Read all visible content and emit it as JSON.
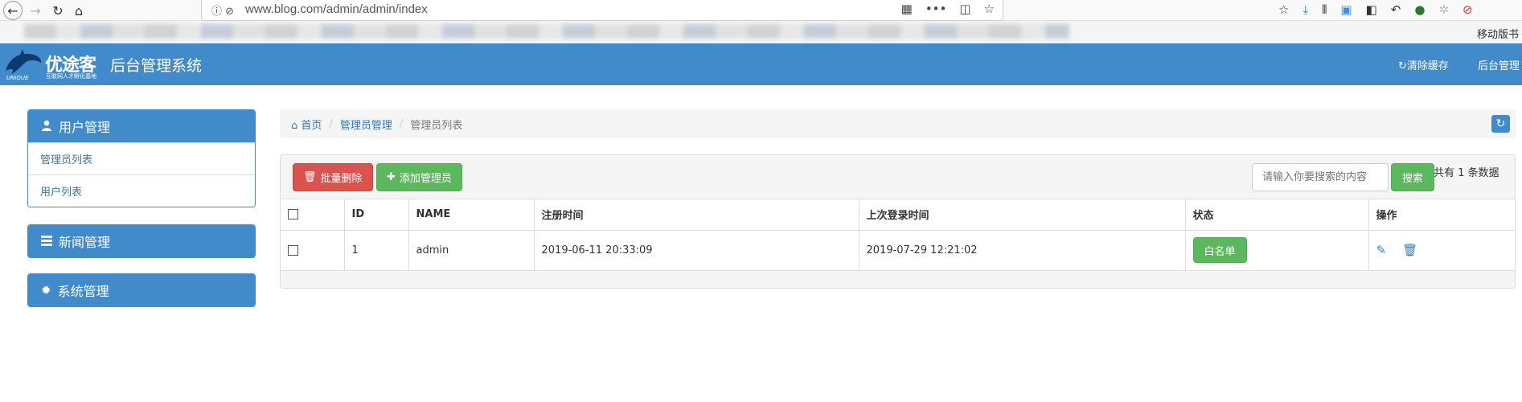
{
  "browser": {
    "url": "www.blog.com/admin/admin/index",
    "mobile_bookmarks": "移动版书"
  },
  "header": {
    "logo_text": "优途客",
    "logo_subtitle": "互联网人才孵化基地",
    "app_title": "后台管理系统",
    "clear_cache": "清除缓存",
    "admin_label": "后台管理"
  },
  "sidebar": {
    "user_panel": {
      "title": "用户管理",
      "items": [
        {
          "label": "管理员列表"
        },
        {
          "label": "用户列表"
        }
      ]
    },
    "news_panel": {
      "title": "新闻管理"
    },
    "system_panel": {
      "title": "系统管理"
    }
  },
  "breadcrumb": {
    "home": "首页",
    "section": "管理员管理",
    "current": "管理员列表"
  },
  "toolbar": {
    "batch_delete": "批量删除",
    "add_admin": "添加管理员",
    "search_placeholder": "请输入你要搜索的内容",
    "search_button": "搜索",
    "total": "共有 1 条数据"
  },
  "table": {
    "headers": [
      "ID",
      "NAME",
      "注册时间",
      "上次登录时间",
      "状态",
      "操作"
    ],
    "rows": [
      {
        "id": "1",
        "name": "admin",
        "registered": "2019-06-11 20:33:09",
        "last_login": "2019-07-29 12:21:02",
        "status": "白名单"
      }
    ]
  },
  "colors": {
    "primary": "#428bca",
    "danger": "#d9534f",
    "success": "#5cb85c",
    "link": "#337ab7"
  }
}
